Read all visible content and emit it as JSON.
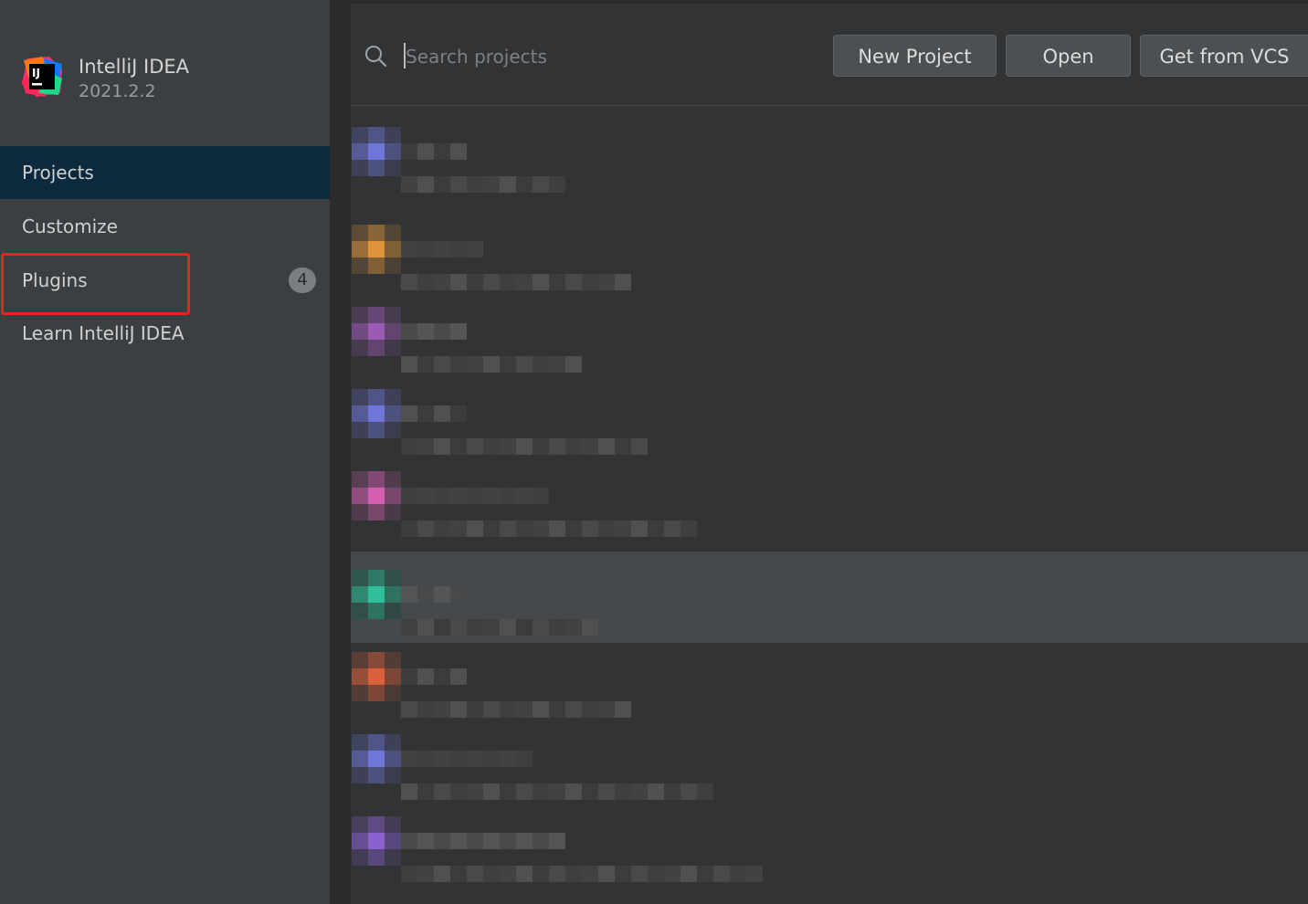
{
  "app": {
    "name": "IntelliJ IDEA",
    "version": "2021.2.2"
  },
  "sidebar": {
    "items": [
      {
        "label": "Projects",
        "active": true
      },
      {
        "label": "Customize",
        "active": false
      },
      {
        "label": "Plugins",
        "active": false,
        "badge": "4"
      },
      {
        "label": "Learn IntelliJ IDEA",
        "active": false
      }
    ]
  },
  "search": {
    "placeholder": "Search projects",
    "value": ""
  },
  "toolbar": {
    "new_project_label": "New Project",
    "open_label": "Open",
    "vcs_label": "Get from VCS"
  },
  "projects": [
    {
      "accent": "#6f76d8",
      "name": "[redacted]",
      "path": "[redacted]"
    },
    {
      "accent": "#e0943a",
      "name": "[redacted]",
      "path": "[redacted]"
    },
    {
      "accent": "#9b5bb5",
      "name": "[redacted]",
      "path": "[redacted]"
    },
    {
      "accent": "#6f76d8",
      "name": "[redacted]",
      "path": "[redacted]"
    },
    {
      "accent": "#d35fb0",
      "name": "[redacted]",
      "path": "[redacted]"
    },
    {
      "accent": "#2fbf9a",
      "name": "[redacted]",
      "path": "[redacted]",
      "selected": true
    },
    {
      "accent": "#d9603a",
      "name": "[redacted]",
      "path": "[redacted]"
    },
    {
      "accent": "#6f76d8",
      "name": "[redacted]",
      "path": "[redacted]"
    },
    {
      "accent": "#8a62d0",
      "name": "[redacted]",
      "path": "[redacted]"
    }
  ],
  "colors": {
    "sidebar_bg": "#3c3f41",
    "active_nav_bg": "#0d293e",
    "main_bg": "#313335",
    "highlight_border": "#e8231e",
    "button_bg": "#4c5052"
  },
  "icons": {
    "logo": "intellij-logo-icon",
    "search": "search-icon"
  }
}
